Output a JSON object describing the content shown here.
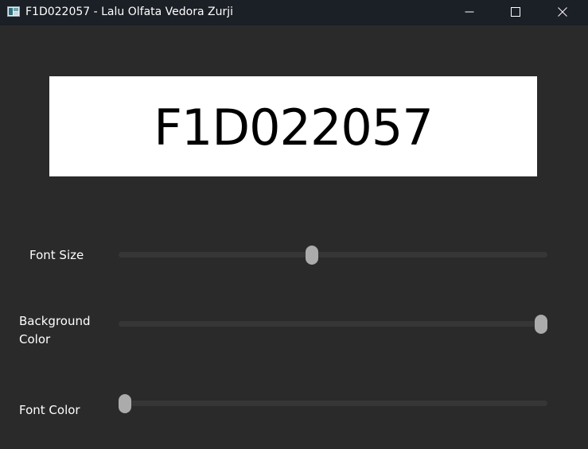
{
  "window": {
    "title": "F1D022057 - Lalu Olfata Vedora Zurji",
    "icon": "app-window-icon",
    "controls": [
      "minimize-icon",
      "maximize-icon",
      "close-icon"
    ]
  },
  "display": {
    "text": "F1D022057",
    "background_color": "#ffffff",
    "font_color": "#000000"
  },
  "controls": {
    "font_size": {
      "label": "Font Size",
      "value": 0.45
    },
    "background_color": {
      "label": "Background Color",
      "value": 1.0
    },
    "font_color": {
      "label": "Font Color",
      "value": 0.0
    }
  },
  "colors": {
    "window_background": "#2a2a2a",
    "titlebar": "#1b1f26",
    "slider_track": "#363636",
    "slider_thumb": "#ababab"
  }
}
